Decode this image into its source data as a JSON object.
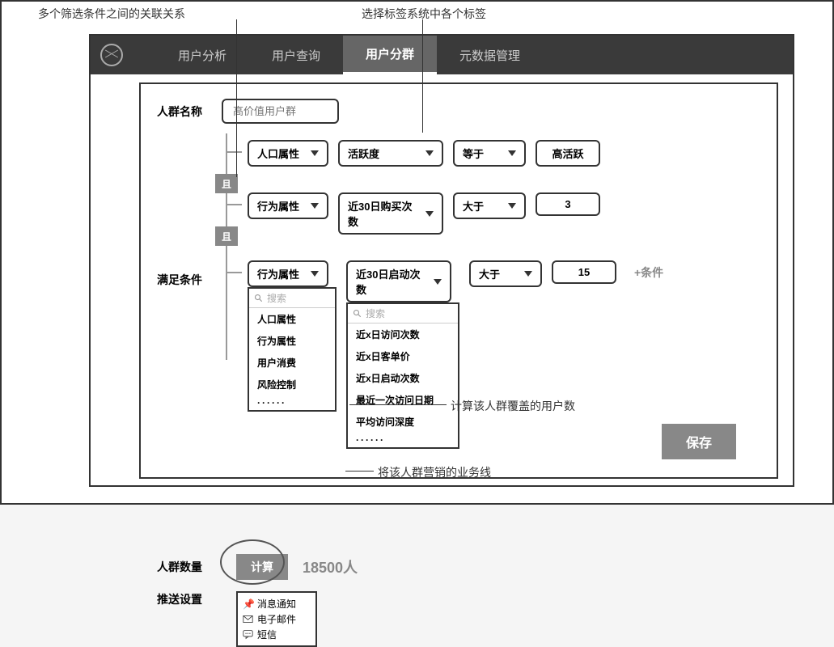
{
  "annotations": {
    "relation": "多个筛选条件之间的关联关系",
    "tag_select": "选择标签系统中各个标签",
    "count_desc": "计算该人群覆盖的用户数",
    "push_desc": "将该人群营销的业务线"
  },
  "nav": {
    "items": [
      "用户分析",
      "用户查询",
      "用户分群",
      "元数据管理"
    ],
    "active_index": 2
  },
  "form": {
    "group_name_label": "人群名称",
    "group_name_placeholder": "高价值用户群",
    "satisfy_label": "满足条件",
    "count_label": "人群数量",
    "push_label": "推送设置"
  },
  "conditions": {
    "and_label": "且",
    "rows": [
      {
        "category": "人口属性",
        "metric": "活跃度",
        "operator": "等于",
        "value": "高活跃"
      },
      {
        "category": "行为属性",
        "metric": "近30日购买次数",
        "operator": "大于",
        "value": "3"
      },
      {
        "category": "行为属性",
        "metric": "近30日启动次数",
        "operator": "大于",
        "value": "15"
      }
    ],
    "add_label": "+条件"
  },
  "dropdowns": {
    "search_placeholder": "搜索",
    "category_options": [
      "人口属性",
      "行为属性",
      "用户消费",
      "风险控制"
    ],
    "metric_options": [
      "近x日访问次数",
      "近x日客单价",
      "近x日启动次数",
      "最近一次访问日期",
      "平均访问深度"
    ]
  },
  "count": {
    "calc_button": "计算",
    "value": "18500人"
  },
  "push": {
    "options": [
      "消息通知",
      "电子邮件",
      "短信"
    ]
  },
  "save_button": "保存"
}
